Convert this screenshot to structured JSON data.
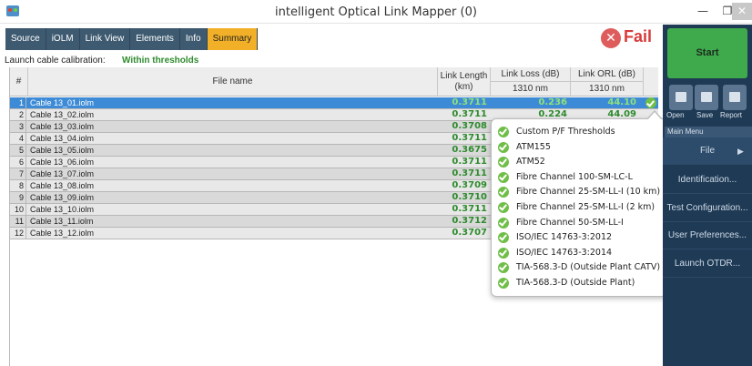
{
  "window": {
    "title": "intelligent Optical Link Mapper (0)",
    "minimize": "—",
    "maximize": "❐",
    "close": "✕"
  },
  "tabs": [
    {
      "label": "Source",
      "active": false
    },
    {
      "label": "iOLM",
      "active": false
    },
    {
      "label": "Link View",
      "active": false
    },
    {
      "label": "Elements",
      "active": false
    },
    {
      "label": "Info",
      "active": false
    },
    {
      "label": "Summary",
      "active": true
    }
  ],
  "status": {
    "icon": "✕",
    "text": "Fail",
    "color": "#d83b3b"
  },
  "calibration": {
    "label": "Launch cable calibration:",
    "value": "Within thresholds"
  },
  "table": {
    "headers": {
      "num": "#",
      "file": "File name",
      "length_top": "Link Length",
      "length_bottom": "(km)",
      "loss": "Link Loss (dB)",
      "loss_sub": "1310 nm",
      "orl": "Link ORL (dB)",
      "orl_sub": "1310 nm"
    },
    "rows": [
      {
        "num": "1",
        "file": "Cable 13_01.iolm",
        "length": "0.3711",
        "loss": "0.236",
        "orl": "44.10"
      },
      {
        "num": "2",
        "file": "Cable 13_02.iolm",
        "length": "0.3711",
        "loss": "0.224",
        "orl": "44.09"
      },
      {
        "num": "3",
        "file": "Cable 13_03.iolm",
        "length": "0.3708",
        "loss": "",
        "orl": ""
      },
      {
        "num": "4",
        "file": "Cable 13_04.iolm",
        "length": "0.3711",
        "loss": "",
        "orl": ""
      },
      {
        "num": "5",
        "file": "Cable 13_05.iolm",
        "length": "0.3675",
        "loss": "",
        "orl": ""
      },
      {
        "num": "6",
        "file": "Cable 13_06.iolm",
        "length": "0.3711",
        "loss": "",
        "orl": ""
      },
      {
        "num": "7",
        "file": "Cable 13_07.iolm",
        "length": "0.3711",
        "loss": "",
        "orl": ""
      },
      {
        "num": "8",
        "file": "Cable 13_08.iolm",
        "length": "0.3709",
        "loss": "",
        "orl": ""
      },
      {
        "num": "9",
        "file": "Cable 13_09.iolm",
        "length": "0.3710",
        "loss": "",
        "orl": ""
      },
      {
        "num": "10",
        "file": "Cable 13_10.iolm",
        "length": "0.3711",
        "loss": "",
        "orl": ""
      },
      {
        "num": "11",
        "file": "Cable 13_11.iolm",
        "length": "0.3712",
        "loss": "",
        "orl": ""
      },
      {
        "num": "12",
        "file": "Cable 13_12.iolm",
        "length": "0.3707",
        "loss": "",
        "orl": ""
      }
    ]
  },
  "thresholds_popup": {
    "items": [
      "Custom P/F Thresholds",
      "ATM155",
      "ATM52",
      "Fibre Channel 100-SM-LC-L",
      "Fibre Channel 25-SM-LL-I (10 km)",
      "Fibre Channel 25-SM-LL-I (2 km)",
      "Fibre Channel 50-SM-LL-I",
      "ISO/IEC 14763-3:2012",
      "ISO/IEC 14763-3:2014",
      "TIA-568.3-D (Outside Plant CATV)",
      "TIA-568.3-D (Outside Plant)"
    ]
  },
  "right_panel": {
    "start": "Start",
    "open": "Open",
    "save": "Save",
    "report": "Report",
    "menu_header": "Main Menu",
    "file": "File",
    "file_arrow": "▶",
    "identification": "Identification...",
    "test_config": "Test Configuration...",
    "user_prefs": "User Preferences...",
    "launch_otdr": "Launch OTDR..."
  },
  "colors": {
    "pass_green": "#2e8b2e",
    "selected_row": "#3d8bd6",
    "active_tab": "#f1b028",
    "tab_bg": "#3e5a70",
    "panel_bg": "#1f3a55",
    "start_green": "#3eaa4c"
  }
}
